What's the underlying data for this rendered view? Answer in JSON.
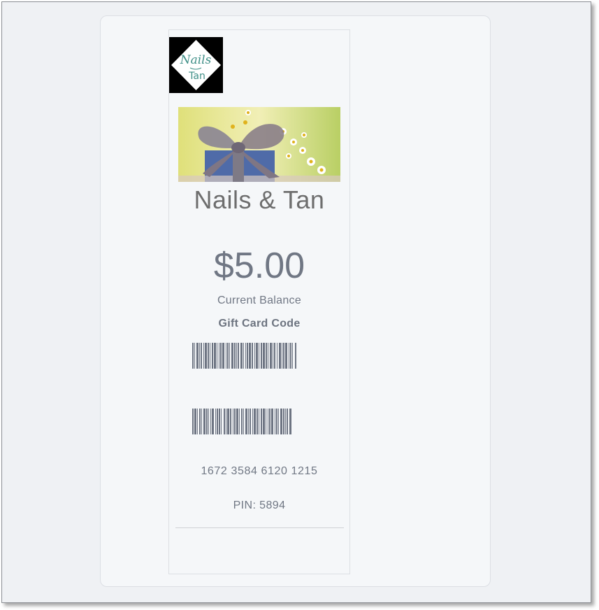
{
  "logo": {
    "text_line1": "Nails",
    "text_line2": "Tan",
    "icon": "nails-and-tan-logo"
  },
  "hero_image": {
    "description_icon": "gift-box-with-flowers-image"
  },
  "card": {
    "business_name": "Nails & Tan",
    "balance": "$5.00",
    "balance_label": "Current Balance",
    "code_label": "Gift Card Code",
    "card_number": "1672 3584 6120 1215",
    "pin": "PIN: 5894"
  },
  "colors": {
    "window_bg": "#eff1f4",
    "panel_bg": "#f5f7f9",
    "text_gray": "#707784",
    "barcode": "#6d7482"
  }
}
